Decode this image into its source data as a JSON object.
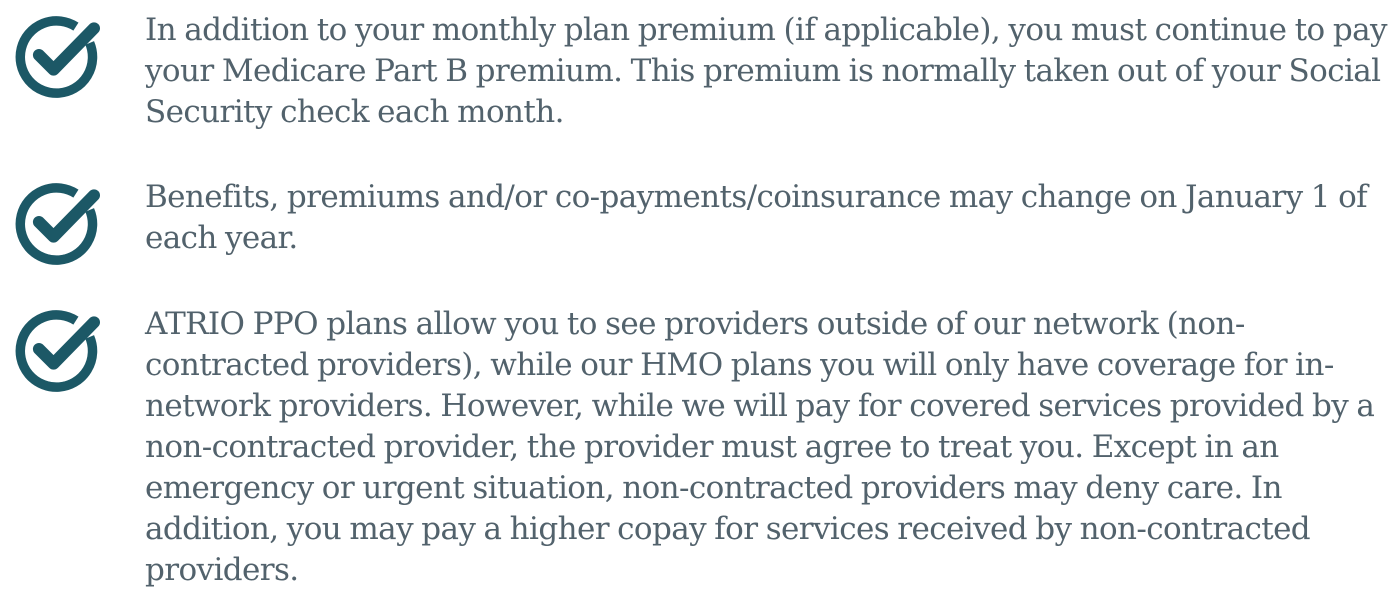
{
  "colors": {
    "icon": "#1c5866",
    "text": "#52626c",
    "background": "#ffffff"
  },
  "items": [
    {
      "icon": "check-circle-icon",
      "text": "In addition to your monthly plan premium (if applicable), you must continue to pay your Medicare Part B premium. This premium is normally taken out of your Social Security check each month."
    },
    {
      "icon": "check-circle-icon",
      "text": "Benefits, premiums and/or co-payments/coinsurance may change on January 1 of each year."
    },
    {
      "icon": "check-circle-icon",
      "text": "ATRIO PPO plans allow you to see providers outside of our network (non-contracted providers), while our HMO plans you will only have coverage for in-network providers. However, while we will pay for covered services provided by a non-contracted provider, the provider must agree to treat you. Except in an emergency or urgent situation, non-contracted providers may deny care. In addition, you may pay a higher copay for services received by non-contracted providers."
    }
  ]
}
